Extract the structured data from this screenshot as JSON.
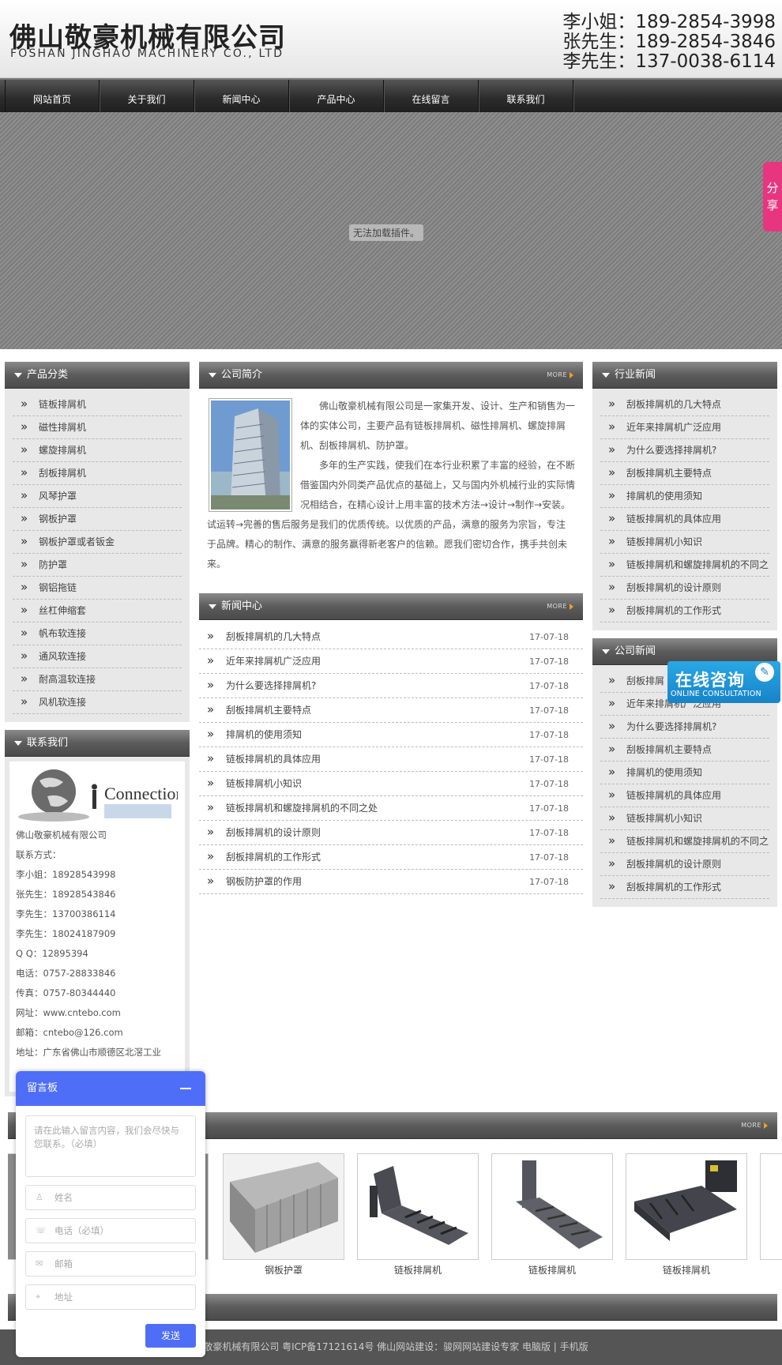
{
  "header": {
    "company_cn": "佛山敬豪机械有限公司",
    "company_en": "FOSHAN JINGHAO MACHINERY CO., LTD",
    "phones": [
      "李小姐：189-2854-3998",
      "张先生：189-2854-3846",
      "李先生：137-0038-6114"
    ]
  },
  "nav": [
    "网站首页",
    "关于我们",
    "新闻中心",
    "产品中心",
    "在线留言",
    "联系我们"
  ],
  "banner": {
    "plugin_message": "无法加载插件。"
  },
  "share": "分享",
  "product_category": {
    "title": "产品分类",
    "items": [
      "链板排屑机",
      "磁性排屑机",
      "螺旋排屑机",
      "刮板排屑机",
      "风琴护罩",
      "钢板护罩",
      "钢板护罩或者钣金",
      "防护罩",
      "钢铝拖链",
      "丝杠伸缩套",
      "帆布软连接",
      "通风软连接",
      "耐高温软连接",
      "风机软连接"
    ]
  },
  "contact": {
    "title": "联系我们",
    "image_text": "Connection",
    "lines": [
      "佛山敬豪机械有限公司",
      "联系方式：",
      "李小姐：18928543998",
      "张先生：18928543846",
      "李先生：13700386114",
      "李先生：18024187909",
      "Q Q：12895394",
      "电话：0757-28833846",
      "传真：0757-80344440",
      "网址：www.cntebo.com",
      "邮箱：cntebo@126.com",
      "地址：广东省佛山市顺德区北滘工业"
    ]
  },
  "about": {
    "title": "公司简介",
    "more": "MORE",
    "para1": "佛山敬豪机械有限公司是一家集开发、设计、生产和销售为一体的实体公司，主要产品有链板排屑机、磁性排屑机、螺旋排屑机、刮板排屑机、防护罩。",
    "para2": "多年的生产实践，使我们在本行业积累了丰富的经验，在不断借鉴国内外同类产品优点的基础上，又与国内外机械行业的实际情况相结合，在精心设计上用丰富的技术方法→设计→制作→安装。试运转→完善的售后服务是我们的优质传统。以优质的产品，满意的服务为宗旨，专注于品牌。精心的制作、满意的服务赢得新老客户的信赖。愿我们密切合作，携手共创未来。"
  },
  "news": {
    "title": "新闻中心",
    "more": "MORE",
    "items": [
      {
        "title": "刮板排屑机的几大特点",
        "date": "17-07-18"
      },
      {
        "title": "近年来排屑机广泛应用",
        "date": "17-07-18"
      },
      {
        "title": "为什么要选择排屑机?",
        "date": "17-07-18"
      },
      {
        "title": "刮板排屑机主要特点",
        "date": "17-07-18"
      },
      {
        "title": "排屑机的使用须知",
        "date": "17-07-18"
      },
      {
        "title": "链板排屑机的具体应用",
        "date": "17-07-18"
      },
      {
        "title": "链板排屑机小知识",
        "date": "17-07-18"
      },
      {
        "title": "链板排屑机和螺旋排屑机的不同之处",
        "date": "17-07-18"
      },
      {
        "title": "刮板排屑机的设计原则",
        "date": "17-07-18"
      },
      {
        "title": "刮板排屑机的工作形式",
        "date": "17-07-18"
      },
      {
        "title": "钢板防护罩的作用",
        "date": "17-07-18"
      }
    ]
  },
  "industry_news": {
    "title": "行业新闻",
    "items": [
      "刮板排屑机的几大特点",
      "近年来排屑机广泛应用",
      "为什么要选择排屑机?",
      "刮板排屑机主要特点",
      "排屑机的使用须知",
      "链板排屑机的具体应用",
      "链板排屑机小知识",
      "链板排屑机和螺旋排屑机的不同之",
      "刮板排屑机的设计原则",
      "刮板排屑机的工作形式"
    ]
  },
  "company_news": {
    "title": "公司新闻",
    "items": [
      "刮板排屑",
      "近年来排屑机广泛应用",
      "为什么要选择排屑机?",
      "刮板排屑机主要特点",
      "排屑机的使用须知",
      "链板排屑机的具体应用",
      "链板排屑机小知识",
      "链板排屑机和螺旋排屑机的不同之",
      "刮板排屑机的设计原则",
      "刮板排屑机的工作形式"
    ]
  },
  "products": {
    "more": "MORE",
    "items": [
      "钢板护罩",
      "链板排屑机",
      "链板排屑机",
      "链板排屑机"
    ]
  },
  "consult": {
    "title": "在线咨询",
    "subtitle": "ONLINE CONSULTATION"
  },
  "message_board": {
    "title": "留言板",
    "content_placeholder": "请在此输入留言内容，我们会尽快与您联系。（必填）",
    "name": "姓名",
    "phone": "电话（必填）",
    "email": "邮箱",
    "address": "地址",
    "send": "发送"
  },
  "footer": {
    "text": "山敬豪机械有限公司 粤ICP备17121614号 佛山网站建设：骏网网站建设专家 电脑版 | 手机版"
  }
}
